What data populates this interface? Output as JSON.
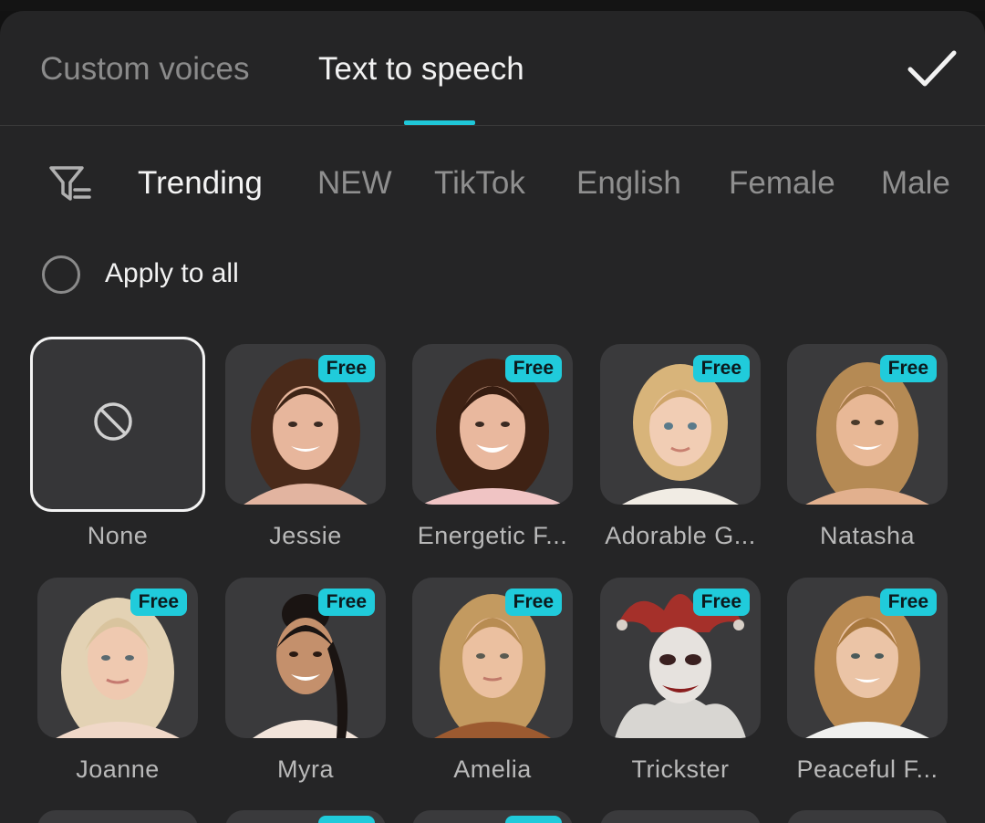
{
  "header": {
    "tabs": [
      {
        "label": "Custom voices",
        "active": false
      },
      {
        "label": "Text to speech",
        "active": true
      }
    ],
    "confirm_icon": "checkmark-icon"
  },
  "filters": {
    "icon": "filter-icon",
    "chips": [
      {
        "label": "Trending",
        "active": true
      },
      {
        "label": "NEW"
      },
      {
        "label": "TikTok"
      },
      {
        "label": "English"
      },
      {
        "label": "Female"
      },
      {
        "label": "Male"
      }
    ]
  },
  "apply_to_all": {
    "label": "Apply to all",
    "checked": false
  },
  "voices": [
    {
      "name": "None",
      "badge": "",
      "selected": true
    },
    {
      "name": "Jessie",
      "badge": "Free"
    },
    {
      "name": "Energetic F...",
      "badge": "Free"
    },
    {
      "name": "Adorable G...",
      "badge": "Free"
    },
    {
      "name": "Natasha",
      "badge": "Free"
    },
    {
      "name": "Joanne",
      "badge": "Free"
    },
    {
      "name": "Myra",
      "badge": "Free"
    },
    {
      "name": "Amelia",
      "badge": "Free"
    },
    {
      "name": "Trickster",
      "badge": "Free"
    },
    {
      "name": "Peaceful F...",
      "badge": "Free"
    }
  ],
  "colors": {
    "accent": "#20cbdb",
    "background": "#252526",
    "card": "#3a3a3c"
  }
}
